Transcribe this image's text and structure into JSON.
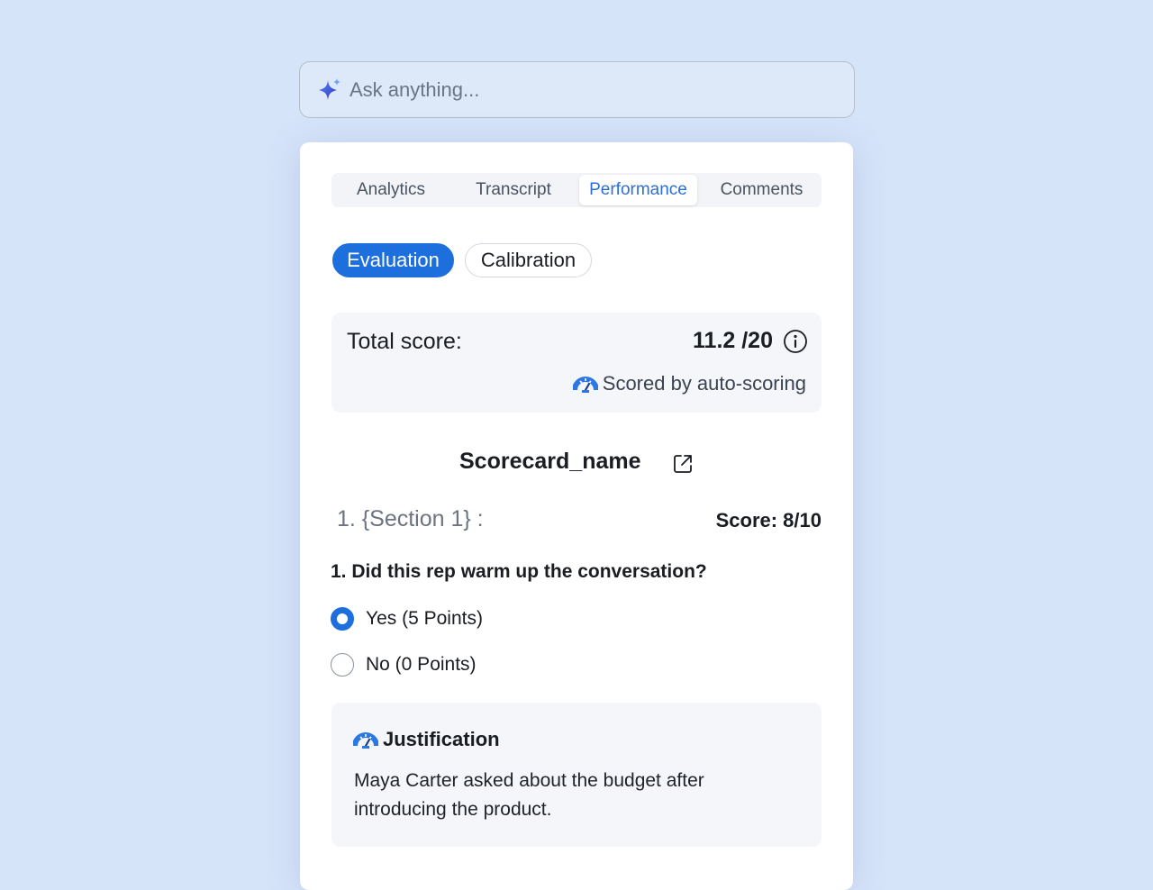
{
  "search": {
    "placeholder": "Ask anything...",
    "icon": "sparkle-icon"
  },
  "tabs": [
    {
      "label": "Analytics",
      "active": false
    },
    {
      "label": "Transcript",
      "active": false
    },
    {
      "label": "Performance",
      "active": true
    },
    {
      "label": "Comments",
      "active": false
    }
  ],
  "mode": {
    "evaluation_label": "Evaluation",
    "calibration_label": "Calibration",
    "selected": "Evaluation"
  },
  "score": {
    "label": "Total score:",
    "value": "11.2 /20",
    "auto_label": "Scored by auto-scoring"
  },
  "scorecard": {
    "name": "Scorecard_name"
  },
  "section": {
    "title": "1. {Section 1} :",
    "score": "Score: 8/10"
  },
  "question": {
    "text": "1.  Did this rep warm up the conversation?",
    "options": [
      {
        "label": "Yes (5 Points)",
        "selected": true
      },
      {
        "label": "No (0 Points)",
        "selected": false
      }
    ]
  },
  "justification": {
    "title": "Justification",
    "text": "Maya Carter asked about the budget after introducing the product."
  },
  "colors": {
    "accent": "#1e6fde",
    "background": "#d6e4fa"
  }
}
